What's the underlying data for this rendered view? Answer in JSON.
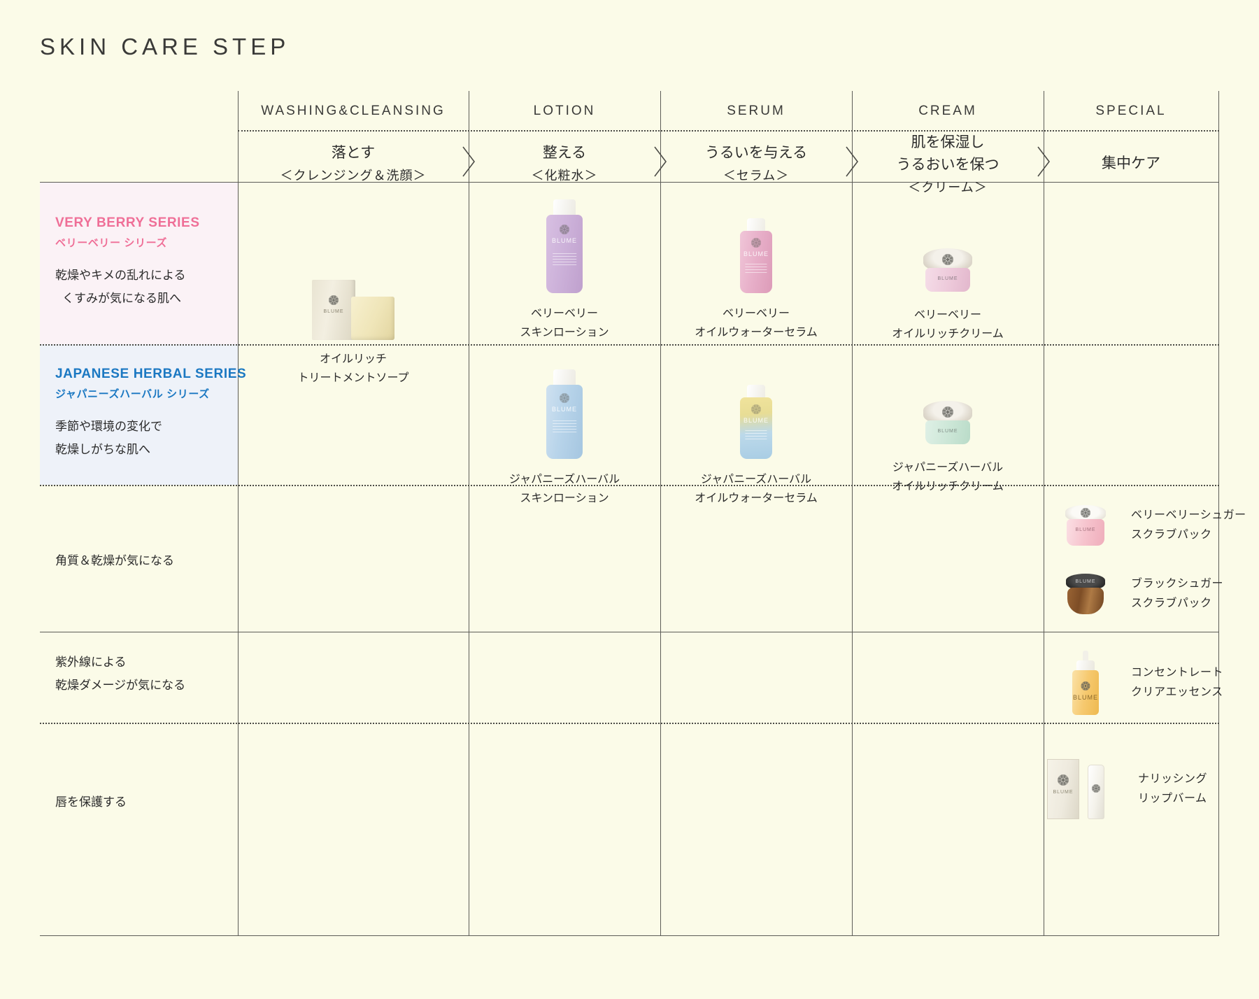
{
  "page": {
    "title": "SKIN CARE STEP",
    "background_color": "#fbfbe8"
  },
  "colors": {
    "berry_accent": "#ef6f97",
    "herbal_accent": "#1b78c2",
    "berry_row_bg": "#fbf2f6",
    "herbal_row_bg": "#eef2f9",
    "rule": "#5c5c57"
  },
  "columns": [
    {
      "key": "washing",
      "en": "WASHING&CLEANSING",
      "jp_main": "落とす",
      "jp_sub": "＜クレンジング＆洗顔＞"
    },
    {
      "key": "lotion",
      "en": "LOTION",
      "jp_main": "整える",
      "jp_sub": "＜化粧水＞"
    },
    {
      "key": "serum",
      "en": "SERUM",
      "jp_main": "うるいを与える",
      "jp_sub": "＜セラム＞"
    },
    {
      "key": "cream",
      "en": "CREAM",
      "jp_main_line1": "肌を保湿し",
      "jp_main_line2": "うるおいを保つ",
      "jp_sub": "＜クリーム＞"
    },
    {
      "key": "special",
      "en": "SPECIAL",
      "jp_main": "集中ケア",
      "jp_sub": ""
    }
  ],
  "series": [
    {
      "key": "very-berry",
      "en": "VERY BERRY SERIES",
      "jp": "ベリーベリー シリーズ",
      "desc_line1": "乾燥やキメの乱れによる",
      "desc_line2": "くすみが気になる肌へ",
      "accent": "#ef6f97"
    },
    {
      "key": "japanese-herbal",
      "en": "JAPANESE HERBAL SERIES",
      "jp": "ジャパニーズハーバル シリーズ",
      "desc_line1": "季節や環境の変化で",
      "desc_line2": "乾燥しがちな肌へ",
      "accent": "#1b78c2"
    }
  ],
  "concern_rows": [
    {
      "key": "scrub",
      "label": "角質＆乾燥が気になる"
    },
    {
      "key": "uv",
      "label_line1": "紫外線による",
      "label_line2": "乾燥ダメージが気になる"
    },
    {
      "key": "lip",
      "label": "唇を保護する"
    }
  ],
  "products": {
    "soap": {
      "name_line1": "オイルリッチ",
      "name_line2": "トリートメントソープ",
      "icon": "soap-box-product"
    },
    "berry_lotion": {
      "name_line1": "ベリーベリー",
      "name_line2": "スキンローション",
      "icon": "lotion-bottle-product"
    },
    "berry_serum": {
      "name_line1": "ベリーベリー",
      "name_line2": "オイルウォーターセラム",
      "icon": "serum-bottle-product"
    },
    "berry_cream": {
      "name_line1": "ベリーベリー",
      "name_line2": "オイルリッチクリーム",
      "icon": "cream-jar-product"
    },
    "herbal_lotion": {
      "name_line1": "ジャパニーズハーバル",
      "name_line2": "スキンローション",
      "icon": "lotion-bottle-product"
    },
    "herbal_serum": {
      "name_line1": "ジャパニーズハーバル",
      "name_line2": "オイルウォーターセラム",
      "icon": "serum-bottle-product"
    },
    "herbal_cream": {
      "name_line1": "ジャパニーズハーバル",
      "name_line2": "オイルリッチクリーム",
      "icon": "cream-jar-product"
    },
    "berry_scrub": {
      "name_line1": "ベリーベリーシュガー",
      "name_line2": "スクラブパック",
      "icon": "pink-scrub-jar-product"
    },
    "black_scrub": {
      "name_line1": "ブラックシュガー",
      "name_line2": "スクラブパック",
      "icon": "black-scrub-jar-product"
    },
    "clear_essence": {
      "name_line1": "コンセントレート",
      "name_line2": "クリアエッセンス",
      "icon": "dropper-bottle-product"
    },
    "lip_balm": {
      "name_line1": "ナリッシング",
      "name_line2": "リップバーム",
      "icon": "lip-balm-product"
    }
  }
}
